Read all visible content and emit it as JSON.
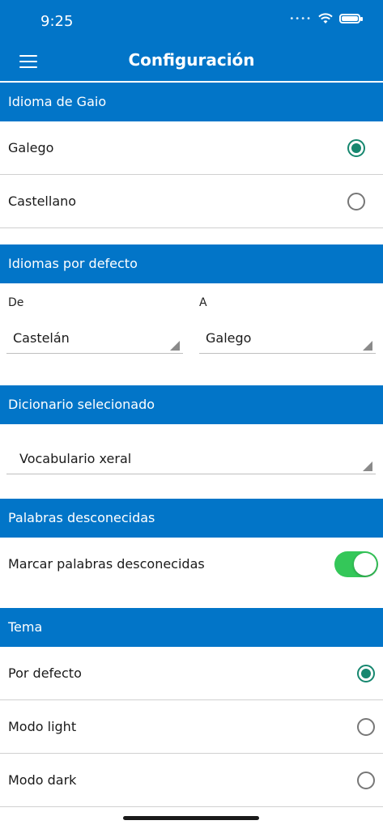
{
  "status": {
    "time": "9:25",
    "dots": "••••"
  },
  "header": {
    "title": "Configuración"
  },
  "language_section": {
    "title": "Idioma de Gaio",
    "options": [
      {
        "label": "Galego",
        "selected": true
      },
      {
        "label": "Castellano",
        "selected": false
      }
    ]
  },
  "default_langs": {
    "title": "Idiomas por defecto",
    "from_label": "De",
    "from_value": "Castelán",
    "to_label": "A",
    "to_value": "Galego"
  },
  "dictionary": {
    "title": "Dicionario selecionado",
    "value": "Vocabulario xeral"
  },
  "unknown_words": {
    "title": "Palabras desconecidas",
    "toggle_label": "Marcar palabras desconecidas",
    "enabled": true
  },
  "theme": {
    "title": "Tema",
    "options": [
      {
        "label": "Por defecto",
        "selected": true
      },
      {
        "label": "Modo light",
        "selected": false
      },
      {
        "label": "Modo dark",
        "selected": false
      }
    ]
  },
  "colors": {
    "primary": "#0275c8",
    "radio_selected": "#16876f",
    "toggle_on": "#34c759"
  }
}
